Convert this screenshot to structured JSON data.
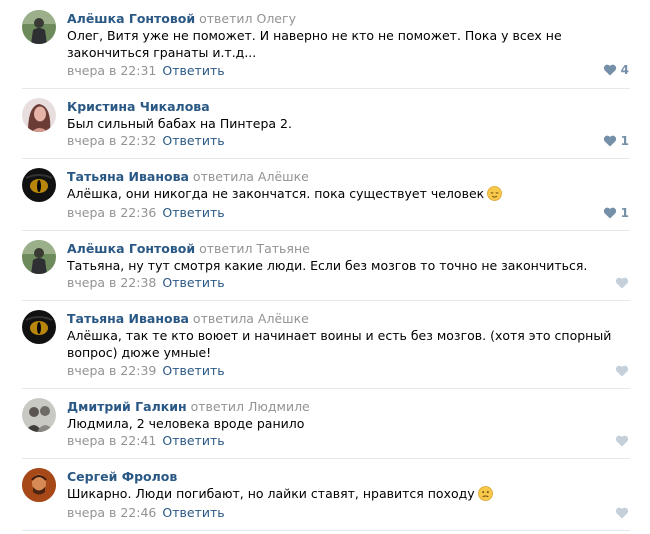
{
  "comments": [
    {
      "author": "Алёшка Гонтовой",
      "replied": "ответил Олегу",
      "text": "Олег, Витя уже не поможет. И наверно не кто не поможет. Пока у всех не закончиться гранаты и.т.д...",
      "date": "вчера в 22:31",
      "reply_label": "Ответить",
      "likes": "4"
    },
    {
      "author": "Кристина Чикалова",
      "replied": "",
      "text": "Был сильный бабах на Пинтера 2.",
      "date": "вчера в 22:32",
      "reply_label": "Ответить",
      "likes": "1"
    },
    {
      "author": "Татьяна Иванова",
      "replied": "ответила Алёшке",
      "text": "Алёшка, они никогда не закончатся. пока существует человек",
      "emoji": "relieved-face",
      "date": "вчера в 22:36",
      "reply_label": "Ответить",
      "likes": "1"
    },
    {
      "author": "Алёшка Гонтовой",
      "replied": "ответил Татьяне",
      "text": "Татьяна, ну тут смотря какие люди. Если без мозгов то точно не закончиться.",
      "date": "вчера в 22:38",
      "reply_label": "Ответить",
      "likes": ""
    },
    {
      "author": "Татьяна Иванова",
      "replied": "ответила Алёшке",
      "text": "Алёшка, так те кто воюет и начинает воины и есть без мозгов. (хотя это спорный вопрос) дюже умные!",
      "date": "вчера в 22:39",
      "reply_label": "Ответить",
      "likes": ""
    },
    {
      "author": "Дмитрий Галкин",
      "replied": "ответил Людмиле",
      "text": "Людмила, 2 человека вроде ранило",
      "date": "вчера в 22:41",
      "reply_label": "Ответить",
      "likes": ""
    },
    {
      "author": "Сергей Фролов",
      "replied": "",
      "text": "Шикарно. Люди погибают, но лайки ставят, нравится походу",
      "emoji": "confused-face",
      "date": "вчера в 22:46",
      "reply_label": "Ответить",
      "likes": ""
    }
  ],
  "colors": {
    "author": "#2a5885",
    "muted": "#939393",
    "like": "#768fa9",
    "like_empty": "#c5d0db",
    "divider": "#e7e8ec"
  }
}
